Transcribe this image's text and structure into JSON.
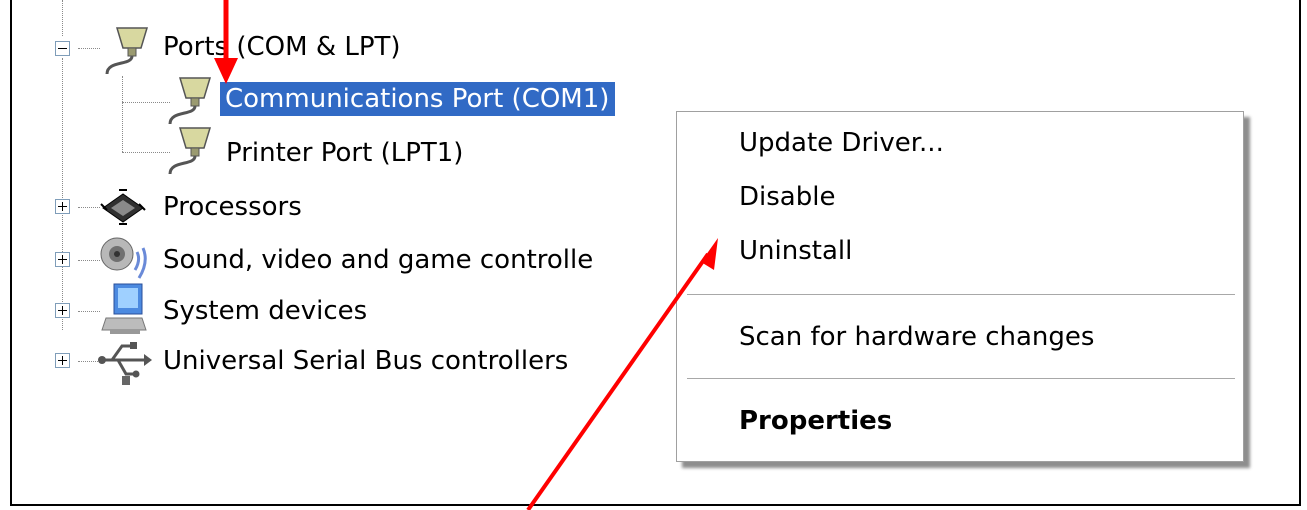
{
  "tree": {
    "items": [
      {
        "label": "Ports (COM & LPT)",
        "expanded": true,
        "icon": "port-connector-icon"
      },
      {
        "label": "Communications Port (COM1)",
        "selected": true,
        "icon": "port-connector-icon"
      },
      {
        "label": "Printer Port (LPT1)",
        "icon": "port-connector-icon"
      },
      {
        "label": "Processors",
        "expanded": false,
        "icon": "processor-chip-icon"
      },
      {
        "label": "Sound, video and game controlle",
        "expanded": false,
        "icon": "speaker-icon"
      },
      {
        "label": "System devices",
        "expanded": false,
        "icon": "computer-icon"
      },
      {
        "label": "Universal Serial Bus controllers",
        "expanded": false,
        "icon": "usb-icon"
      }
    ]
  },
  "context_menu": {
    "items": [
      {
        "label": "Update Driver..."
      },
      {
        "label": "Disable"
      },
      {
        "label": "Uninstall"
      },
      {
        "label": "Scan for hardware changes"
      },
      {
        "label": "Properties",
        "default": true
      }
    ]
  },
  "colors": {
    "selection": "#316ac5",
    "annotation_arrow": "#ff0000"
  }
}
